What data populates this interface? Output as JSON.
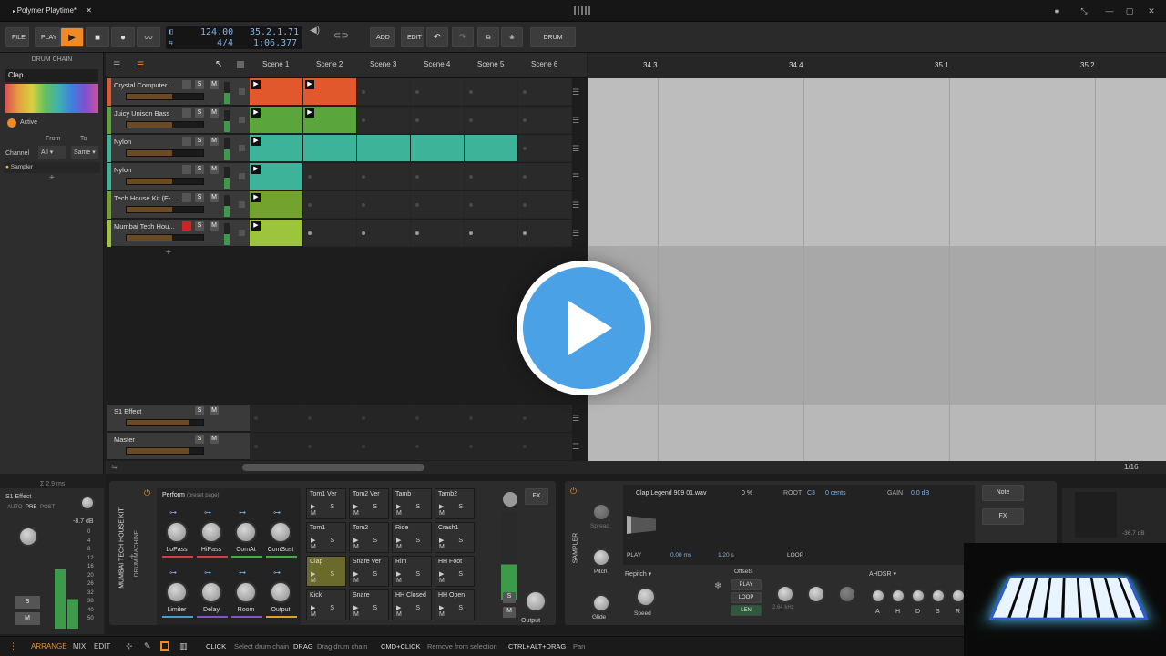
{
  "window": {
    "tab_title": "Polymer Playtime*"
  },
  "toolbar": {
    "file": "FILE",
    "play": "PLAY",
    "tempo": "124.00",
    "signature": "4/4",
    "position": "35.2.1.71",
    "time": "1:06.377",
    "add": "ADD",
    "edit": "EDIT",
    "drum_chain": "DRUM CHAIN"
  },
  "left": {
    "title": "DRUM CHAIN",
    "search": "Clap",
    "active": "Active",
    "from": "From",
    "to": "To",
    "channel": "Channel",
    "from_val": "All",
    "to_val": "Same",
    "sampler": "Sampler",
    "latency": "Σ 2.9 ms",
    "s1effect": "S1 Effect",
    "auto": "AUTO",
    "pre": "PRE",
    "post": "POST",
    "db": "-8.7 dB",
    "s": "S",
    "m": "M",
    "meter_scale": [
      "0",
      "4",
      "8",
      "12",
      "16",
      "20",
      "26",
      "32",
      "38",
      "40",
      "50"
    ]
  },
  "scenes": [
    "Scene 1",
    "Scene 2",
    "Scene 3",
    "Scene 4",
    "Scene 5",
    "Scene 6"
  ],
  "tracks": [
    {
      "name": "Crystal Computer ...",
      "color": "#e0582c",
      "clips": [
        1,
        1,
        0,
        0,
        0,
        0
      ]
    },
    {
      "name": "Juicy Unison Bass",
      "color": "#5aa63c",
      "clips": [
        1,
        1,
        0,
        0,
        0,
        0
      ]
    },
    {
      "name": "Nylon",
      "color": "#3db49a",
      "clips": [
        1,
        1,
        1,
        1,
        1,
        0
      ]
    },
    {
      "name": "Nylon",
      "color": "#3db49a",
      "clips": [
        1,
        0,
        0,
        0,
        0,
        0
      ]
    },
    {
      "name": "Tech House Kit (E-...",
      "color": "#73a22e",
      "clips": [
        1,
        0,
        0,
        0,
        0,
        0
      ]
    },
    {
      "name": "Mumbai Tech Hou...",
      "color": "#9cc43d",
      "clips": [
        1,
        0,
        0,
        0,
        0,
        0
      ]
    }
  ],
  "fx_tracks": [
    "S1 Effect",
    "Master"
  ],
  "ruler": [
    "34.3",
    "34.4",
    "35.1",
    "35.2"
  ],
  "zoom": "1/16",
  "drum_machine": {
    "vertical_title": "MUMBAI TECH HOUSE KIT",
    "vertical_sub": "DRUM MACHINE",
    "preset": "Perform",
    "preset_hint": "(preset page)",
    "knobs": [
      "LoPass",
      "HiPass",
      "ComAt",
      "ComSust",
      "Limiter",
      "Delay",
      "Room",
      "Output"
    ],
    "pads": [
      "Tom1 Ver",
      "Tom2 Ver",
      "Tamb",
      "Tamb2",
      "Tom1",
      "Tom2",
      "Ride",
      "Crash1",
      "Clap",
      "Snare Ver",
      "Rim",
      "HH Foot",
      "Kick",
      "Snare",
      "HH Closed",
      "HH Open"
    ],
    "psm": "▶ S M",
    "fx": "FX",
    "s": "S",
    "m": "M",
    "output": "Output"
  },
  "sampler": {
    "title": "SAMPLER",
    "file": "Clap Legend 909 01.wav",
    "pct": "0 %",
    "root": "ROOT",
    "root_val": "C3",
    "cents": "0 cents",
    "gain": "GAIN",
    "gain_val": "0.0 dB",
    "play": "PLAY",
    "start": "0.00 ms",
    "len": "1.20 s",
    "loop": "LOOP",
    "spread": "Spread",
    "pitch": "Pitch",
    "glide": "Glide",
    "mode": "Repitch",
    "speed": "Speed",
    "offsets": "Offsets",
    "m_play": "PLAY",
    "m_loop": "LOOP",
    "m_len": "LEN",
    "env": "AHDSR",
    "env_letters": [
      "A",
      "H",
      "D",
      "S",
      "R"
    ],
    "freq": "2.64 kHz",
    "note": "Note",
    "fxbtn": "FX",
    "db": "-36.7 dB"
  },
  "status": {
    "arrange": "ARRANGE",
    "mix": "MIX",
    "edit": "EDIT",
    "hints": [
      {
        "k": "CLICK",
        "v": "Select drum chain"
      },
      {
        "k": "DRAG",
        "v": "Drag drum chain"
      },
      {
        "k": "CMD+CLICK",
        "v": "Remove from selection"
      },
      {
        "k": "CTRL+ALT+DRAG",
        "v": "Pan"
      }
    ]
  }
}
